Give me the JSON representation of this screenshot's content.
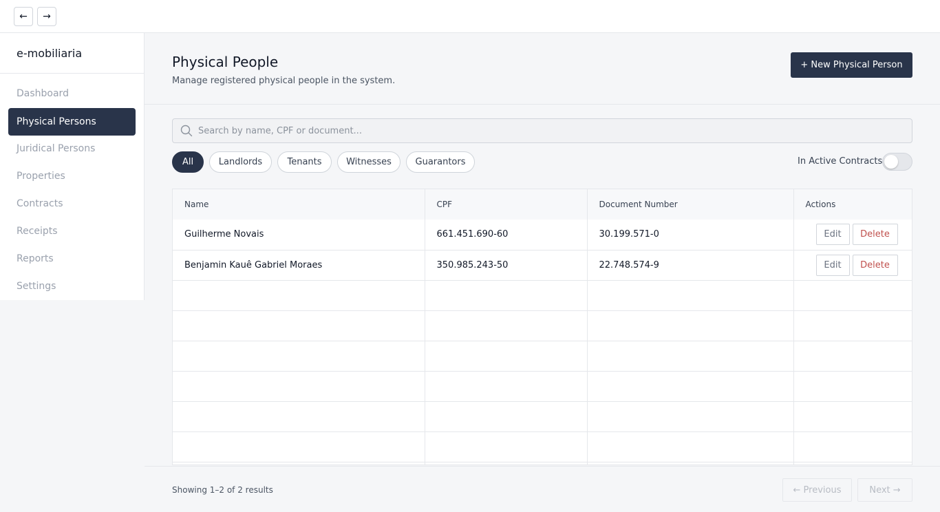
{
  "nav": {
    "back": "←",
    "forward": "→"
  },
  "brand": "e-mobiliaria",
  "sidebar": {
    "items": [
      {
        "label": "Dashboard",
        "active": false
      },
      {
        "label": "Physical Persons",
        "active": true
      },
      {
        "label": "Juridical Persons",
        "active": false
      },
      {
        "label": "Properties",
        "active": false
      },
      {
        "label": "Contracts",
        "active": false
      },
      {
        "label": "Receipts",
        "active": false
      },
      {
        "label": "Reports",
        "active": false
      },
      {
        "label": "Settings",
        "active": false
      }
    ]
  },
  "header": {
    "title": "Physical People",
    "subtitle": "Manage registered physical people in the system.",
    "new_button": "+ New Physical Person"
  },
  "search": {
    "placeholder": "Search by name, CPF or document..."
  },
  "filters": {
    "chips": [
      "All",
      "Landlords",
      "Tenants",
      "Witnesses",
      "Guarantors"
    ],
    "active_chip": "All",
    "toggle_label": "In Active Contracts",
    "toggle_on": false
  },
  "table": {
    "columns": [
      "Name",
      "CPF",
      "Document Number",
      "Actions"
    ],
    "rows": [
      {
        "name": "Guilherme Novais",
        "cpf": "661.451.690-60",
        "document": "30.199.571-0"
      },
      {
        "name": "Benjamin Kauê Gabriel Moraes",
        "cpf": "350.985.243-50",
        "document": "22.748.574-9"
      }
    ],
    "edit_label": "Edit",
    "delete_label": "Delete"
  },
  "footer": {
    "results": "Showing 1–2 of 2 results",
    "previous": "← Previous",
    "next": "Next →"
  },
  "colors": {
    "accent": "#29344a",
    "danger": "#c0504d"
  }
}
